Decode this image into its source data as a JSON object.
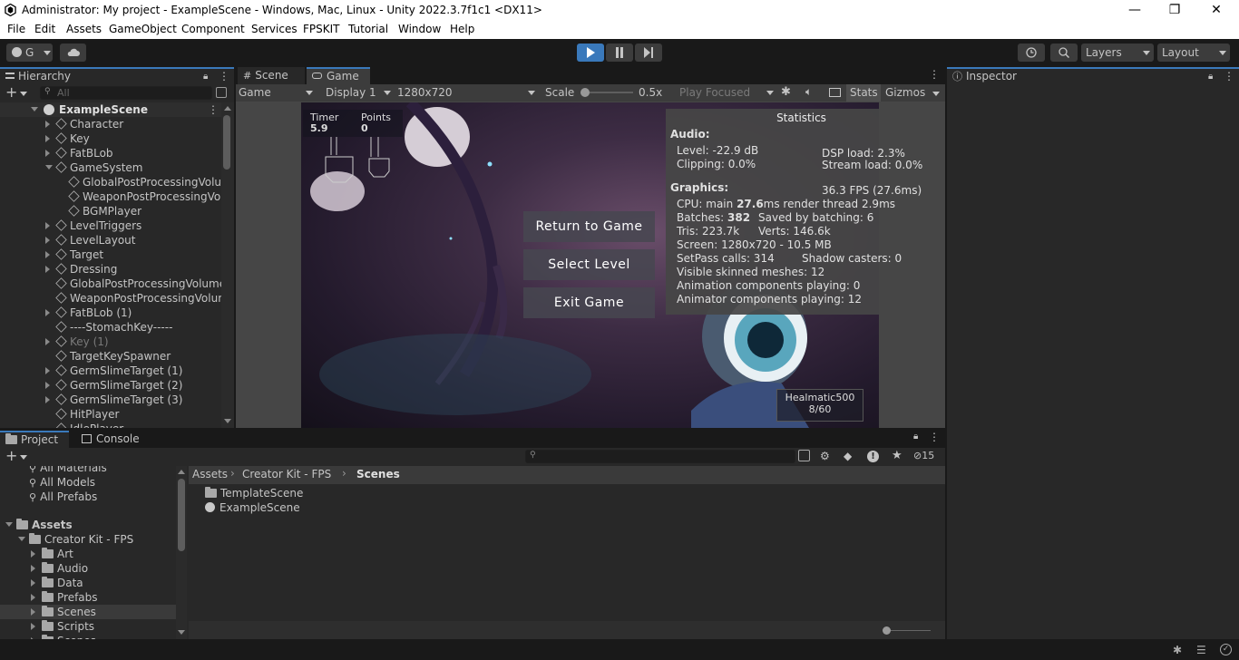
{
  "window": {
    "title": "Administrator: My project - ExampleScene - Windows, Mac, Linux - Unity 2022.3.7f1c1 <DX11>",
    "min": "—",
    "max": "❐",
    "close": "✕"
  },
  "menu": [
    "File",
    "Edit",
    "Assets",
    "GameObject",
    "Component",
    "Services",
    "FPSKIT",
    "Tutorial",
    "Window",
    "Help"
  ],
  "toolbar": {
    "account": "G",
    "layers": "Layers",
    "layout": "Layout"
  },
  "hierarchy": {
    "tab": "Hierarchy",
    "search_placeholder": "All",
    "scene": "ExampleScene",
    "items": [
      {
        "label": "Character",
        "indent": 1,
        "arrow": true
      },
      {
        "label": "Key",
        "indent": 1,
        "arrow": true
      },
      {
        "label": "FatBLob",
        "indent": 1,
        "arrow": true
      },
      {
        "label": "GameSystem",
        "indent": 1,
        "arrow": true,
        "open": true
      },
      {
        "label": "GlobalPostProcessingVolur",
        "indent": 2,
        "arrow": false
      },
      {
        "label": "WeaponPostProcessingVol",
        "indent": 2,
        "arrow": false
      },
      {
        "label": "BGMPlayer",
        "indent": 2,
        "arrow": false
      },
      {
        "label": "LevelTriggers",
        "indent": 1,
        "arrow": true
      },
      {
        "label": "LevelLayout",
        "indent": 1,
        "arrow": true
      },
      {
        "label": "Target",
        "indent": 1,
        "arrow": true
      },
      {
        "label": "Dressing",
        "indent": 1,
        "arrow": true
      },
      {
        "label": "GlobalPostProcessingVolume",
        "indent": 1,
        "arrow": false
      },
      {
        "label": "WeaponPostProcessingVolum",
        "indent": 1,
        "arrow": false
      },
      {
        "label": "FatBLob (1)",
        "indent": 1,
        "arrow": true
      },
      {
        "label": "----StomachKey-----",
        "indent": 1,
        "arrow": false
      },
      {
        "label": "Key (1)",
        "indent": 1,
        "arrow": true,
        "dim": true
      },
      {
        "label": "TargetKeySpawner",
        "indent": 1,
        "arrow": false
      },
      {
        "label": "GermSlimeTarget (1)",
        "indent": 1,
        "arrow": true
      },
      {
        "label": "GermSlimeTarget (2)",
        "indent": 1,
        "arrow": true
      },
      {
        "label": "GermSlimeTarget (3)",
        "indent": 1,
        "arrow": true
      },
      {
        "label": "HitPlayer",
        "indent": 1,
        "arrow": false
      },
      {
        "label": "IdlePlayer",
        "indent": 1,
        "arrow": false
      }
    ]
  },
  "game": {
    "tab_scene": "Scene",
    "tab_game": "Game",
    "mode": "Game",
    "display": "Display 1",
    "resolution": "1280x720",
    "scale_label": "Scale",
    "scale_value": "0.5x",
    "play_focused": "Play Focused",
    "stats": "Stats",
    "gizmos": "Gizmos",
    "hud": {
      "timer_label": "Timer",
      "timer_value": "5.9",
      "points_label": "Points",
      "points_value": "0",
      "weapon": "Healmatic500",
      "ammo": "8/60"
    },
    "menu_buttons": [
      "Return to Game",
      "Select Level",
      "Exit Game"
    ]
  },
  "statistics": {
    "title": "Statistics",
    "audio": "Audio:",
    "level": "Level: -22.9 dB",
    "dsp": "DSP load: 2.3%",
    "clipping": "Clipping: 0.0%",
    "stream": "Stream load: 0.0%",
    "graphics": "Graphics:",
    "fps": "36.3 FPS (27.6ms)",
    "cpu_pre": "CPU: main ",
    "cpu_main": "27.6",
    "cpu_post": "ms  render thread 2.9ms",
    "batches_pre": "Batches: ",
    "batches": "382",
    "saved": "Saved by batching: 6",
    "tris": "Tris: 223.7k",
    "verts": "Verts: 146.6k",
    "screen": "Screen: 1280x720 - 10.5 MB",
    "setpass": "SetPass calls: 314",
    "shadow": "Shadow casters: 0",
    "skinned": "Visible skinned meshes: 12",
    "anim": "Animation components playing: 0",
    "animator": "Animator components playing: 12"
  },
  "inspector": {
    "tab": "Inspector"
  },
  "project": {
    "tab_project": "Project",
    "tab_console": "Console",
    "hidden_count": "15",
    "favorites": [
      "All Materials",
      "All Models",
      "All Prefabs"
    ],
    "tree_root": "Assets",
    "tree_kit": "Creator Kit - FPS",
    "tree_items": [
      "Art",
      "Audio",
      "Data",
      "Prefabs",
      "Scenes",
      "Scripts",
      "Scenes"
    ],
    "breadcrumb": [
      "Assets",
      "Creator Kit - FPS",
      "Scenes"
    ],
    "files": [
      "TemplateScene",
      "ExampleScene"
    ]
  }
}
